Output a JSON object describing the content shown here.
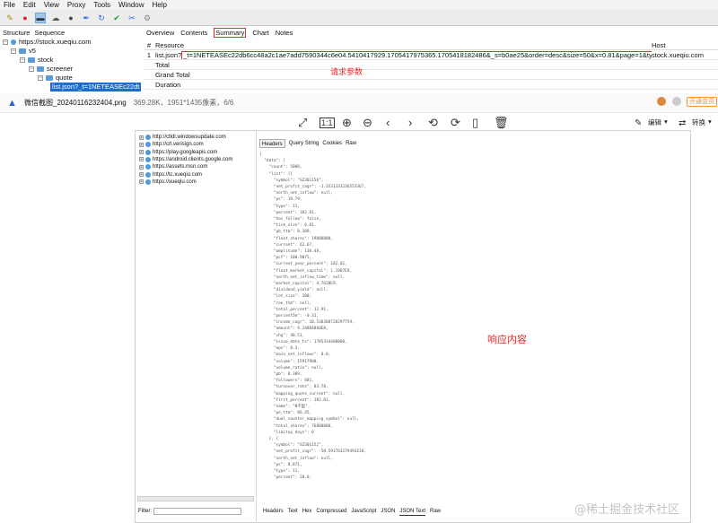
{
  "menu": [
    "File",
    "Edit",
    "View",
    "Proxy",
    "Tools",
    "Window",
    "Help"
  ],
  "toolbar_icons": [
    "broom-icon",
    "record-icon",
    "throttle-icon",
    "breakpoint-icon",
    "stop-icon",
    "pen-icon",
    "refresh-icon",
    "check-icon",
    "tools-icon",
    "settings-icon"
  ],
  "left_tabs": [
    "Structure",
    "Sequence"
  ],
  "tree": {
    "root": "https://stock.xueqiu.com",
    "v5": "v5",
    "stock": "stock",
    "screener": "screener",
    "quote": "quote",
    "selected": "list.json?_t=1NETEASEc22dt"
  },
  "right_tabs": [
    "Overview",
    "Contents",
    "Summary",
    "Chart",
    "Notes"
  ],
  "active_tab": "Summary",
  "table": {
    "hash": "#",
    "resource_header": "Resource",
    "host_header": "Host",
    "row_num": "1",
    "resource_prefix": "list.json?",
    "resource_query": "_t=1NETEASEc22db6cc48a2c1ae7add7590344c6e04.5410417929.1705417975365.1705418182486&_s=b0ae25&order=desc&size=50&x=0.81&page=1&type=sh_sz&",
    "host": "stock.xueqiu.com",
    "rows": [
      "Total",
      "Grand Total",
      "Duration"
    ]
  },
  "labels": {
    "request_params": "请求参数",
    "response_content": "响应内容"
  },
  "viewer": {
    "filename": "微信截图_20240116232404.png",
    "info": "369.28K，1951*1435像素，6/6",
    "vip": "开通会员",
    "edit": "编辑",
    "convert": "转换"
  },
  "inner": {
    "hosts": [
      "http://ctldl.windowsupdate.com",
      "http://crl.verisign.com",
      "https://play.googleapis.com",
      "https://android.clients.google.com",
      "https://assets.msn.com",
      "https://tc.xueqiu.com",
      "https://xueqiu.com"
    ],
    "tabs": [
      "Headers",
      "Query String",
      "Cookies",
      "Raw"
    ],
    "bottom_tabs": [
      "Headers",
      "Text",
      "Hex",
      "Compressed",
      "JavaScript",
      "JSON",
      "JSON Text",
      "Raw"
    ],
    "filter": "Filter:",
    "json_lines": [
      "{",
      "  \"data\": {",
      "    \"count\": 5000,",
      "    \"list\": [{",
      "      \"symbol\": \"SZ301156\",",
      "      \"net_profit_cagr\": -1.3531333236553367,",
      "      \"north_net_inflow\": null,",
      "      \"ps\": 19.79,",
      "      \"type\": 11,",
      "      \"percent\": 182.01,",
      "      \"has_follow\": false,",
      "      \"tick_size\": 0.01,",
      "      \"pb_ttm\": 8.389,",
      "      \"float_shares\": 19000000,",
      "      \"current\": 62.67,",
      "      \"amplitude\": 130.48,",
      "      \"pcf\": 100.9875,",
      "      \"current_year_percent\": 182.01,",
      "      \"float_market_capital\": 1.1907E9,",
      "      \"north_net_inflow_time\": null,",
      "      \"market_capital\": 4.7628E9,",
      "      \"dividend_yield\": null,",
      "      \"lot_size\": 100,",
      "      \"roe_ttm\": null,",
      "      \"total_percent\": 12.91,",
      "      \"percent5m\": -0.31,",
      "      \"income_cagr\": 10.530388728297759,",
      "      \"amount\": 9.24884860E8,",
      "      \"chg\": 40.51,",
      "      \"issue_date_ts\": 1705334400000,",
      "      \"eps\": 0.3,",
      "      \"main_net_inflows\": 0.0,",
      "      \"volume\": 15917900,",
      "      \"volume_ratio\": null,",
      "      \"pb\": 8.389,",
      "      \"followers\": 681,",
      "      \"turnover_rate\": 83.78,",
      "      \"mapping_quote_current\": null,",
      "      \"first_percent\": 182.01,",
      "      \"name\": \"N千里\",",
      "      \"pe_ttm\": 86.45,",
      "      \"dual_counter_mapping_symbol\": null,",
      "      \"total_shares\": 76000000,",
      "      \"limitup_days\": 0",
      "    }, {",
      "      \"symbol\": \"SZ301152\",",
      "      \"net_profit_cagr\": -58.593763279493218,",
      "      \"north_net_inflow\": null,",
      "      \"ps\": 8.871,",
      "      \"type\": 11,",
      "      \"percent\": 20.0,"
    ]
  },
  "watermark": "@稀土掘金技术社区"
}
